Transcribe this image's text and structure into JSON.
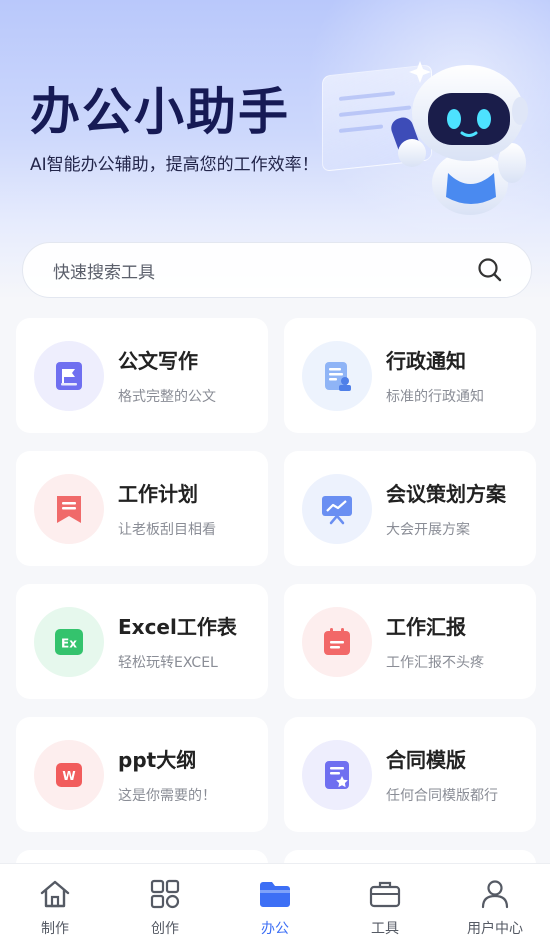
{
  "header": {
    "title": "办公小助手",
    "subtitle": "AI智能办公辅助，提高您的工作效率！"
  },
  "search": {
    "placeholder": "快速搜索工具"
  },
  "tools": [
    {
      "title": "公文写作",
      "desc": "格式完整的公文",
      "icon": "flag-doc-icon",
      "color": "#6f6ff0",
      "bg": "#eeeefd"
    },
    {
      "title": "行政通知",
      "desc": "标准的行政通知",
      "icon": "notice-doc-icon",
      "color": "#6b9bf2",
      "bg": "#edf3fd"
    },
    {
      "title": "工作计划",
      "desc": "让老板刮目相看",
      "icon": "bookmark-list-icon",
      "color": "#f06a6a",
      "bg": "#fdeeee"
    },
    {
      "title": "会议策划方案",
      "desc": "大会开展方案",
      "icon": "presentation-chart-icon",
      "color": "#6a8ff2",
      "bg": "#edf2fd"
    },
    {
      "title": "Excel工作表",
      "desc": "轻松玩转EXCEL",
      "icon": "excel-icon",
      "color": "#34c36d",
      "bg": "#e6f8ed"
    },
    {
      "title": "工作汇报",
      "desc": "工作汇报不头疼",
      "icon": "calendar-report-icon",
      "color": "#f26868",
      "bg": "#fdeeee"
    },
    {
      "title": "ppt大纲",
      "desc": "这是你需要的！",
      "icon": "ppt-word-icon",
      "color": "#f15c5c",
      "bg": "#fdeeee"
    },
    {
      "title": "合同模版",
      "desc": "任何合同模版都行",
      "icon": "contract-star-icon",
      "color": "#6f6ff0",
      "bg": "#eeeefd"
    }
  ],
  "tabbar": {
    "items": [
      {
        "label": "制作",
        "icon": "home-icon"
      },
      {
        "label": "创作",
        "icon": "grid-apps-icon"
      },
      {
        "label": "办公",
        "icon": "folder-icon"
      },
      {
        "label": "工具",
        "icon": "briefcase-icon"
      },
      {
        "label": "用户中心",
        "icon": "user-icon"
      }
    ],
    "active_index": 2,
    "active_color": "#3d6ff5"
  }
}
